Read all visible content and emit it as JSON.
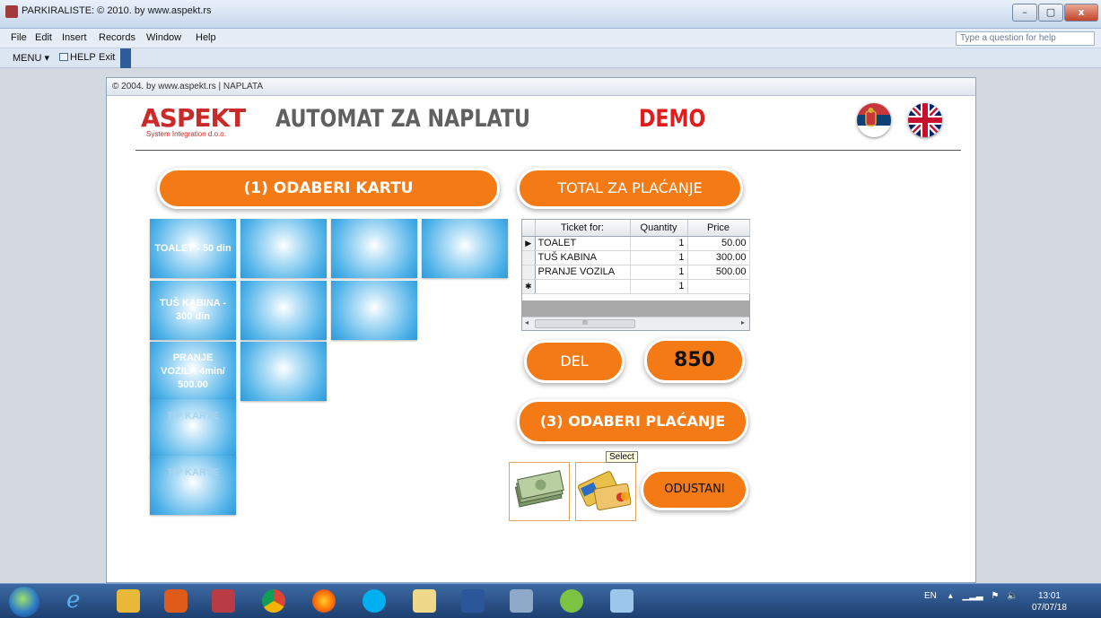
{
  "window": {
    "title": "PARKIRALISTE: © 2010. by www.aspekt.rs",
    "min_glyph": "–",
    "max_glyph": "▢",
    "close_glyph": "x"
  },
  "menu": {
    "items": [
      "File",
      "Edit",
      "Insert",
      "Records",
      "Window",
      "Help"
    ],
    "help_placeholder": "Type a question for help"
  },
  "toolbar": {
    "menu_label": "MENU ▾",
    "help_label": "HELP",
    "exit_label": "Exit"
  },
  "form": {
    "caption": "© 2004. by www.aspekt.rs | NAPLATA",
    "logo_text": "ASPEKT",
    "logo_sub": "System Integration d.o.o.",
    "title": "AUTOMAT ZA NAPLATU",
    "demo": "DEMO"
  },
  "buttons": {
    "choose_ticket": "(1) ODABERI KARTU",
    "total": "TOTAL ZA PLAĆANJE",
    "del": "DEL",
    "total_value": "850",
    "choose_payment": "(3) ODABERI PLAĆANJE",
    "cancel": "ODUSTANI"
  },
  "tickets": {
    "row1": "TOALET - 50 din",
    "row2": "TUŠ KABINA - 300 din",
    "row3": "PRANJE VOZILA 4min/ 500.00",
    "row4": "TIP KARTE",
    "row5": "TIP KARTE"
  },
  "grid": {
    "headers": [
      "Ticket for:",
      "Quantity",
      "Price"
    ],
    "rows": [
      {
        "marker": "▶",
        "ticket": "TOALET",
        "qty": "1",
        "price": "50.00"
      },
      {
        "marker": "",
        "ticket": "TUŠ KABINA",
        "qty": "1",
        "price": "300.00"
      },
      {
        "marker": "",
        "ticket": "PRANJE VOZILA",
        "qty": "1",
        "price": "500.00"
      },
      {
        "marker": "✱",
        "ticket": "",
        "qty": "1",
        "price": ""
      }
    ],
    "scroll_thumb": "III"
  },
  "tooltip": "Select",
  "tray": {
    "lang": "EN",
    "time": "13:01",
    "date": "07/07/18"
  },
  "colors": {
    "orange": "#f47a15",
    "demo_red": "#e31b1b",
    "tile_blue": "#4fb2e8"
  }
}
